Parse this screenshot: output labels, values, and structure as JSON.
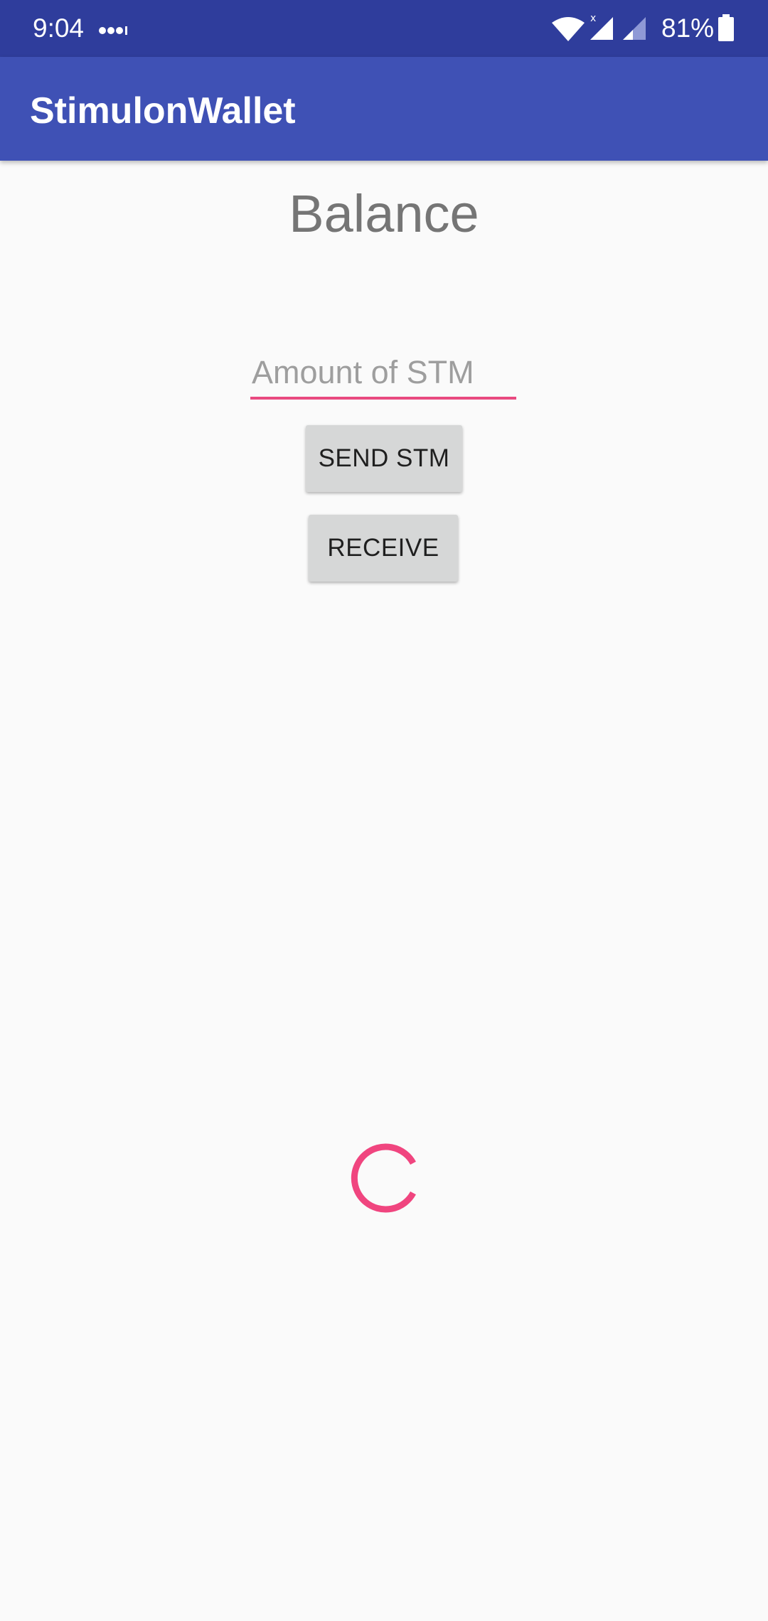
{
  "status_bar": {
    "time": "9:04",
    "battery_percent": "81%",
    "icons": [
      "notification-dots-icon",
      "wifi-icon",
      "cell-signal-icon",
      "cell-signal-2-icon",
      "battery-icon"
    ]
  },
  "app_bar": {
    "title": "StimulonWallet",
    "color": "#3f51b5"
  },
  "main": {
    "balance_label": "Balance",
    "amount_input": {
      "value": "",
      "placeholder": "Amount of STM"
    },
    "send_button_label": "SEND STM",
    "receive_button_label": "RECEIVE"
  },
  "spinner": {
    "icon": "loading-spinner-icon",
    "color": "#f0457f"
  },
  "colors": {
    "status_bar": "#2f3d9c",
    "accent": "#e94a80",
    "background": "#fafafa"
  }
}
